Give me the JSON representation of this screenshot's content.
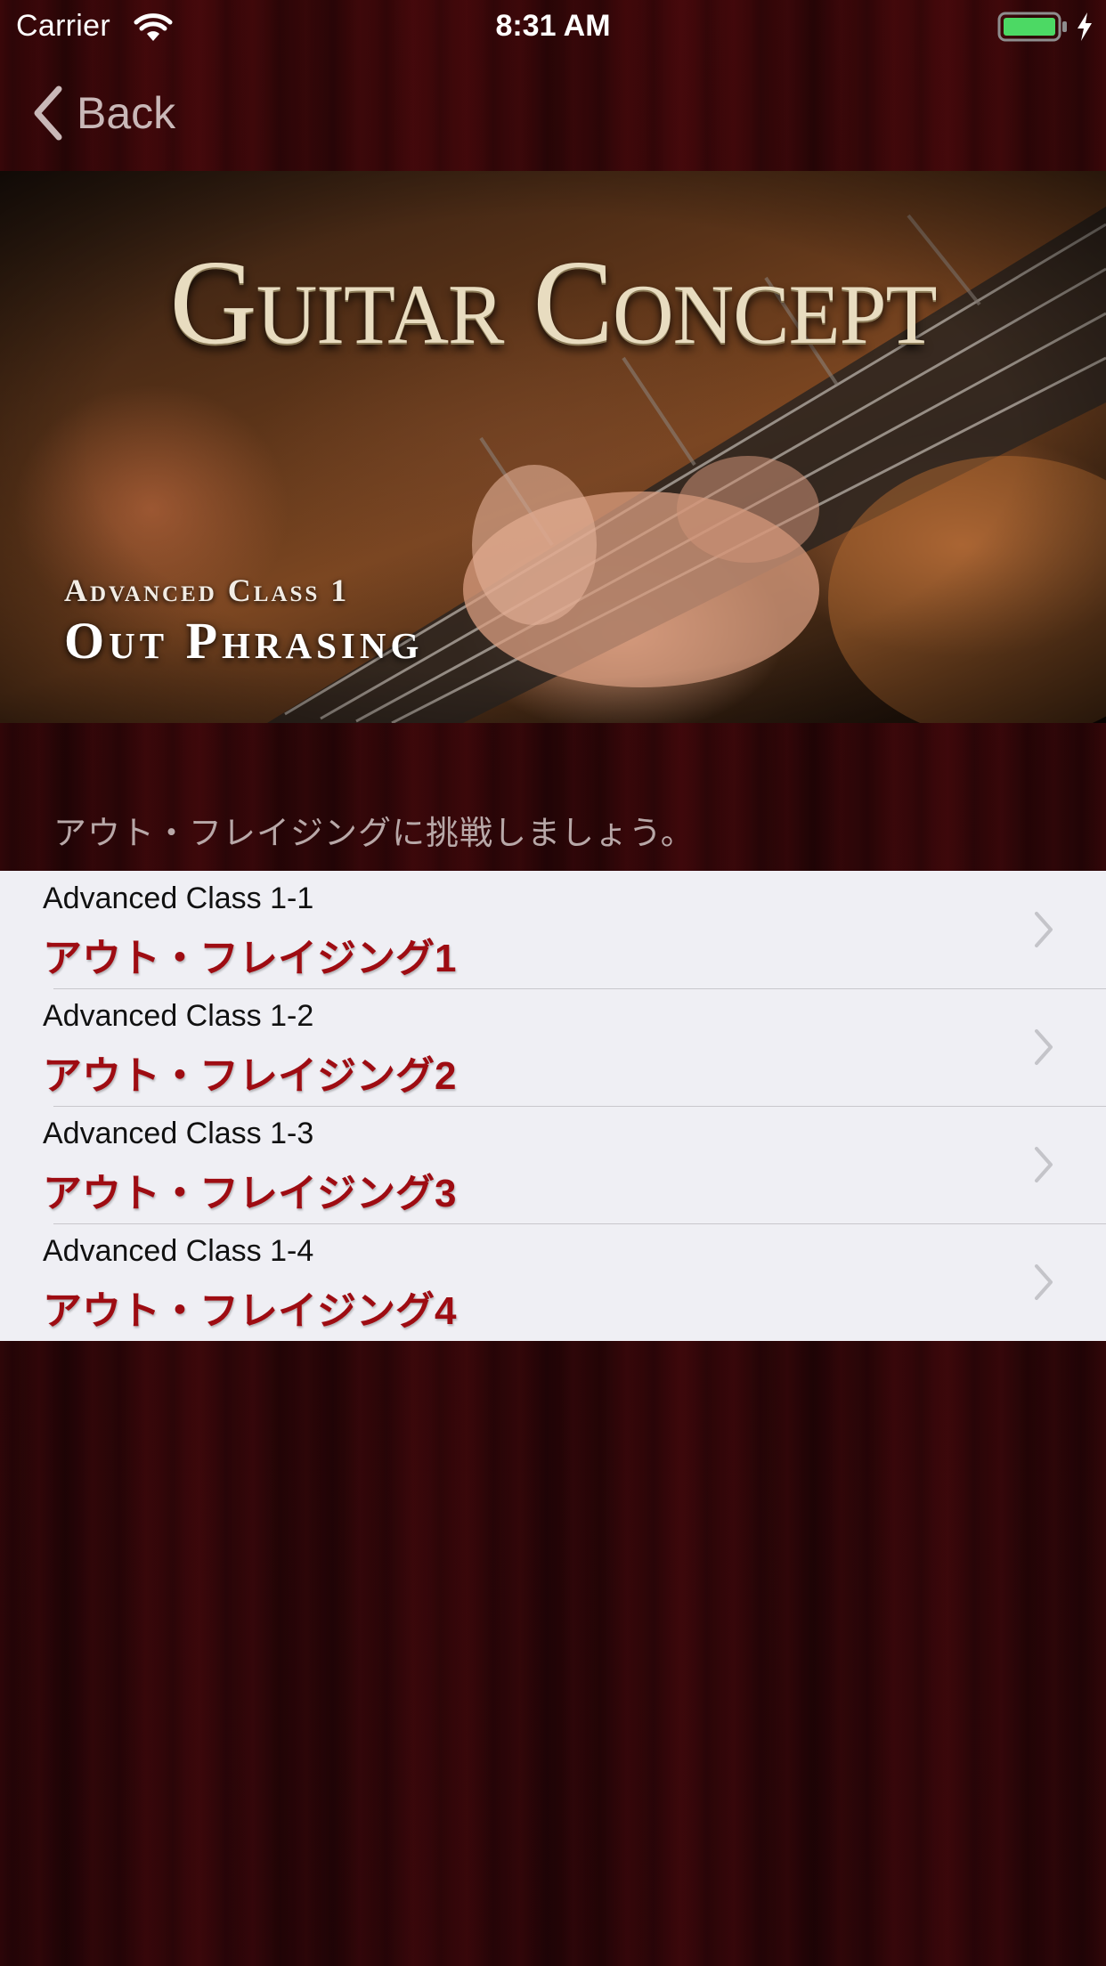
{
  "status_bar": {
    "carrier": "Carrier",
    "time": "8:31 AM"
  },
  "nav": {
    "back_label": "Back"
  },
  "banner": {
    "logo": "Guitar Concept",
    "subtitle": "Advanced Class 1",
    "title": "Out Phrasing"
  },
  "section": {
    "header": "アウト・フレイジングに挑戦しましょう。"
  },
  "lessons": [
    {
      "code": "Advanced Class 1-1",
      "title": "アウト・フレイジング1"
    },
    {
      "code": "Advanced Class 1-2",
      "title": "アウト・フレイジング2"
    },
    {
      "code": "Advanced Class 1-3",
      "title": "アウト・フレイジング3"
    },
    {
      "code": "Advanced Class 1-4",
      "title": "アウト・フレイジング4"
    }
  ],
  "colors": {
    "lesson_title": "#9e0c12",
    "list_background": "#efeff4",
    "battery_fill": "#4cd964",
    "wood_background": "#2c0508"
  },
  "icons": {
    "status": [
      "wifi-icon",
      "battery-icon",
      "charging-bolt-icon"
    ],
    "nav": "back-chevron-icon",
    "row": "chevron-right-icon"
  }
}
